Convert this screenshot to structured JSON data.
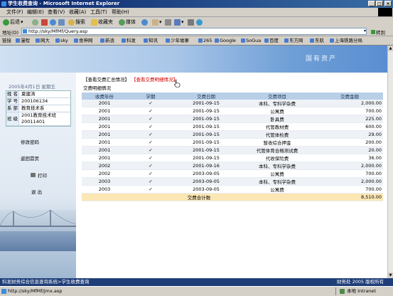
{
  "window": {
    "title": "学生收费查询 - Microsoft Internet Explorer",
    "min": "_",
    "max": "□",
    "close": "×"
  },
  "menu": [
    "文件(F)",
    "编辑(E)",
    "查看(V)",
    "收藏(A)",
    "工具(T)",
    "帮助(H)"
  ],
  "toolbar": {
    "back": "后退",
    "search": "搜索",
    "favorites": "收藏夹",
    "media": "媒体"
  },
  "address": {
    "label": "地址(D)",
    "url": "http://sky/MfMf/Query.asp",
    "go": "转到"
  },
  "links": {
    "label": "链接",
    "items": [
      "漫程",
      "网大",
      "sky",
      "食神网",
      "新浪",
      "科发",
      "知讯",
      "少年墟寨",
      "265",
      "Google",
      "SoGua",
      "百度",
      "东方网",
      "东航",
      "上海铁路分局"
    ]
  },
  "banner": {
    "text": "国有资产"
  },
  "sidebar": {
    "date": "2005年4月1日 星期五",
    "user": [
      {
        "label": "姓 名",
        "value": "夏建涛"
      },
      {
        "label": "学 号",
        "value": "200106134"
      },
      {
        "label": "系 部",
        "value": "教育技术系"
      },
      {
        "label": "班 级",
        "value": "2001教育技术班"
      },
      {
        "label": "",
        "value": "20011401"
      }
    ],
    "change_password": "修改密码",
    "home": "返回首页",
    "print": "打印",
    "logout": "退 出"
  },
  "main": {
    "tab_summary": "【查看交费汇总情况】",
    "tab_detail": "【查看交费明细情况】",
    "subtitle": "交费明细情况",
    "headers": [
      "收费年份",
      "学期",
      "交费日期",
      "交费项目",
      "交费金额"
    ],
    "rows": [
      [
        "2001",
        "✓",
        "2001-09-15",
        "本科、专科学杂费",
        "2,000.00"
      ],
      [
        "2001",
        "✓",
        "2001-09-15",
        "公寓费",
        "700.00"
      ],
      [
        "2001",
        "✓",
        "2001-09-15",
        "卧具费",
        "225.00"
      ],
      [
        "2001",
        "✓",
        "2001-09-15",
        "代管教材费",
        "600.00"
      ],
      [
        "2001",
        "✓",
        "2001-09-15",
        "代管体检费",
        "29.00"
      ],
      [
        "2001",
        "✓",
        "2001-09-15",
        "暂收综合押金",
        "200.00"
      ],
      [
        "2001",
        "✓",
        "2001-09-15",
        "代管体育合格测试费",
        "20.00"
      ],
      [
        "2001",
        "✓",
        "2001-09-15",
        "代收保险费",
        "36.00"
      ],
      [
        "2002",
        "✓",
        "2001-09-16",
        "本科、专科学杂费",
        "2,000.00"
      ],
      [
        "2002",
        "✓",
        "2003-09-05",
        "公寓费",
        "700.00"
      ],
      [
        "2003",
        "✓",
        "2003-09-05",
        "本科、专科学杂费",
        "2,000.00"
      ],
      [
        "2003",
        "✓",
        "2003-09-05",
        "公寓费",
        "700.00"
      ]
    ],
    "total_label": "交费合计数",
    "total_value": "8,510.00"
  },
  "footer": {
    "left": "科发财务综合信息查询系统>学生收费查询",
    "right": "财务处 2005 版权所有"
  },
  "status": {
    "url": "http://sky/MfMf/jmx.asp",
    "zone": "本地 Intranet"
  },
  "colors": {
    "header_bg": "#b9cfe6",
    "total_bg": "#fbe6b4",
    "link_red": "#d40000",
    "footer_bg": "#1f3e78"
  }
}
